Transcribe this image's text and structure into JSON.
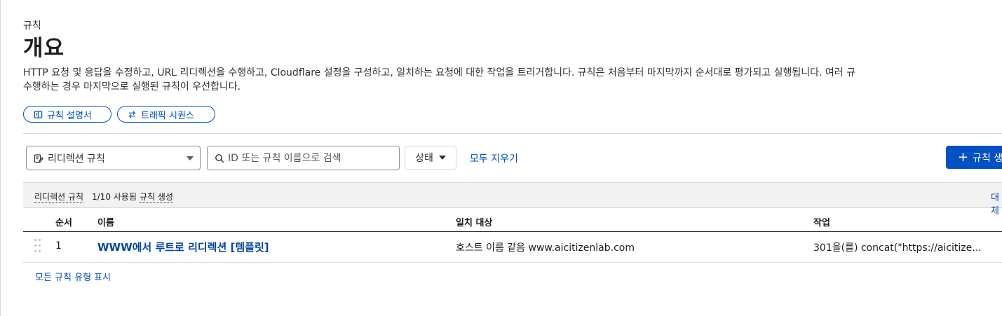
{
  "breadcrumb": "규칙",
  "title": "개요",
  "description": {
    "line1": "HTTP 요청 및 응답을 수정하고, URL 리디렉션을 수행하고, Cloudflare 설정을 구성하고, 일치하는 요청에 대한 작업을 트리거합니다. 규칙은 처음부터 마지막까지 순서대로 평가되고 실행됩니다. 여러 규",
    "line2": "수행하는 경우 마지막으로 실행된 규칙이 우선합니다."
  },
  "pills": {
    "docs": "규칙 설명서",
    "trace": "트래픽 시퀀스"
  },
  "filters": {
    "rule_type_value": "리디렉션 규칙",
    "search_placeholder": "ID 또는 규칙 이름으로 검색",
    "status_label": "상태",
    "clear_all": "모두 지우기",
    "create_label": "규칙 생성"
  },
  "section": {
    "type_label": "리디렉션 규칙",
    "usage": "1/10 사용됨",
    "create_link": "규칙 생성",
    "right_link": "대체"
  },
  "table": {
    "columns": [
      "순서",
      "이름",
      "일치 대상",
      "작업"
    ],
    "rows": [
      {
        "order": "1",
        "name": "WWW에서 루트로 리디렉션 [템플릿]",
        "match": "호스트 이름 같음 www.aicitizenlab.com",
        "action": "301을(를) concat(\"https://aicitize..."
      }
    ]
  },
  "show_all_link": "모든 규칙 유형 표시",
  "colors": {
    "accent": "#0051c3",
    "header_bg": "#f2f2f2",
    "border": "#d9d9d9"
  },
  "icons": {
    "docs": "book-icon",
    "trace": "arrows-swap-icon",
    "rule_type": "edit-document-icon",
    "search": "search-icon",
    "create": "plus-icon",
    "drag": "drag-handle-icon"
  }
}
